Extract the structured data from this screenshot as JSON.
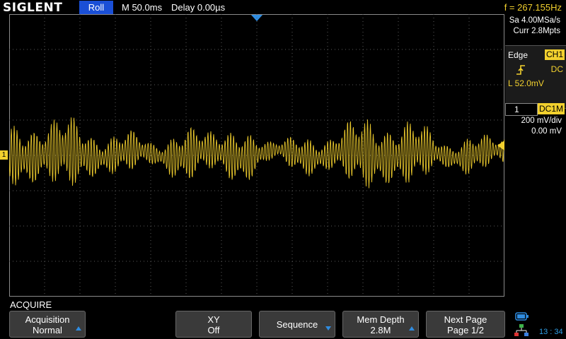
{
  "topbar": {
    "logo": "SIGLENT",
    "mode": "Roll",
    "timebase": "M 50.0ms",
    "delay": "Delay 0.00µs",
    "frequency": "f = 267.155Hz"
  },
  "acquisition_info": {
    "sample_rate": "Sa 4.00MSa/s",
    "memory": "Curr 2.8Mpts"
  },
  "trigger": {
    "type": "Edge",
    "source": "CH1",
    "slope_icon": "rising-edge-icon",
    "coupling": "DC",
    "level": "L  52.0mV"
  },
  "channel": {
    "number": "1",
    "coupling": "DC1M",
    "volts_per_div": "200 mV/div",
    "offset": "0.00 mV",
    "marker": "1"
  },
  "menu": {
    "title": "ACQUIRE",
    "softkeys": [
      {
        "line1": "Acquisition",
        "line2": "Normal",
        "has_arrow": true
      },
      {
        "line1": "XY",
        "line2": "Off",
        "has_arrow": false
      },
      {
        "line1": "Sequence",
        "line2": "",
        "has_arrow": true
      },
      {
        "line1": "Mem Depth",
        "line2": "2.8M",
        "has_arrow": true
      },
      {
        "line1": "Next Page",
        "line2": "Page 1/2",
        "has_arrow": false
      }
    ]
  },
  "status": {
    "clock": "13 : 34",
    "icons": [
      "usb-icon",
      "network-icon"
    ]
  },
  "colors": {
    "ch1": "#f2d02e",
    "accent": "#1a4fd6",
    "grid": "#5a5a5a"
  }
}
